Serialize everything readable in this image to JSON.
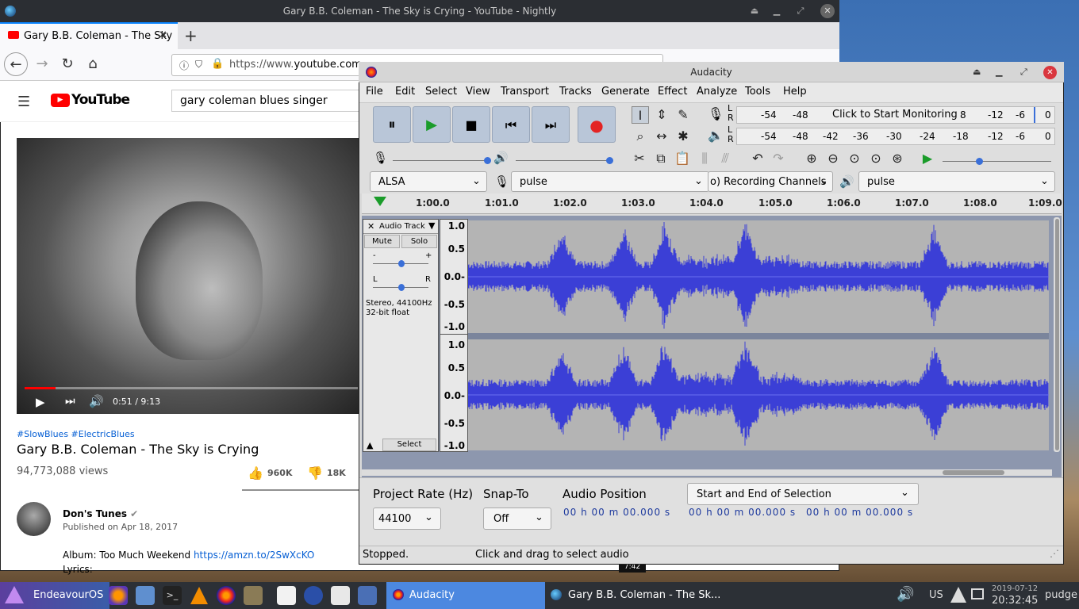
{
  "firefox": {
    "window_title": "Gary B.B. Coleman - The Sky is Crying - YouTube - Nightly",
    "tab_title": "Gary B.B. Coleman - The Sky",
    "url_prefix": "https://www.",
    "url_domain": "youtube.com",
    "new_tab": "+",
    "close": "✕"
  },
  "youtube": {
    "logo": "YouTube",
    "search_value": "gary coleman blues singer",
    "time": "0:51 / 9:13",
    "progress_fraction": 0.093,
    "hashtags": "#SlowBlues #ElectricBlues",
    "title": "Gary B.B. Coleman - The Sky is Crying",
    "views": "94,773,088 views",
    "likes": "960K",
    "dislikes": "18K",
    "channel": "Don's Tunes",
    "published": "Published on Apr 18, 2017",
    "album_prefix": "Album: Too Much Weekend ",
    "album_link": "https://amzn.to/2SwXcKO",
    "lyrics": "Lyrics:",
    "thumb_time": "7:42"
  },
  "audacity": {
    "window_title": "Audacity",
    "menu": [
      "File",
      "Edit",
      "Select",
      "View",
      "Transport",
      "Tracks",
      "Generate",
      "Effect",
      "Analyze",
      "Tools",
      "Help"
    ],
    "meter_rec_ticks": [
      "-54",
      "-48"
    ],
    "meter_rec_tail": [
      "-12",
      "-6",
      "0"
    ],
    "meter_monitor": "Click to Start Monitoring",
    "meter_monitor_clip": "8",
    "meter_play_ticks": [
      "-54",
      "-48",
      "-42",
      "-36",
      "-30",
      "-24",
      "-18",
      "-12",
      "-6",
      "0"
    ],
    "meter_L": "L",
    "meter_R": "R",
    "host": "ALSA",
    "rec_device": "pulse",
    "channels": "o) Recording Channels",
    "play_device": "pulse",
    "ruler": [
      "1:00.0",
      "1:01.0",
      "1:02.0",
      "1:03.0",
      "1:04.0",
      "1:05.0",
      "1:06.0",
      "1:07.0",
      "1:08.0",
      "1:09.0"
    ],
    "track_name": "Audio Track",
    "mute": "Mute",
    "solo": "Solo",
    "gain_minus": "-",
    "gain_plus": "+",
    "pan_l": "L",
    "pan_r": "R",
    "track_info": "Stereo, 44100Hz",
    "track_format": "32-bit float",
    "select": "Select",
    "scale": [
      "1.0",
      "0.5",
      "0.0-",
      "-0.5",
      "-1.0"
    ],
    "project_rate_label": "Project Rate (Hz)",
    "project_rate": "44100",
    "snap_label": "Snap-To",
    "snap_value": "Off",
    "audio_pos_label": "Audio Position",
    "selection_mode": "Start and End of Selection",
    "time_field": "00 h 00 m 00.000 s",
    "status_left": "Stopped.",
    "status_right": "Click and drag to select audio",
    "colors": {
      "wave": "#3b3fd6",
      "button": "#b9c6d8"
    }
  },
  "taskbar": {
    "menu": "EndeavourOS",
    "task1": "Audacity",
    "task2": "Gary B.B. Coleman - The Sk...",
    "keyboard": "US",
    "date": "2019-07-12",
    "time": "20:32:45",
    "user": "pudge"
  }
}
